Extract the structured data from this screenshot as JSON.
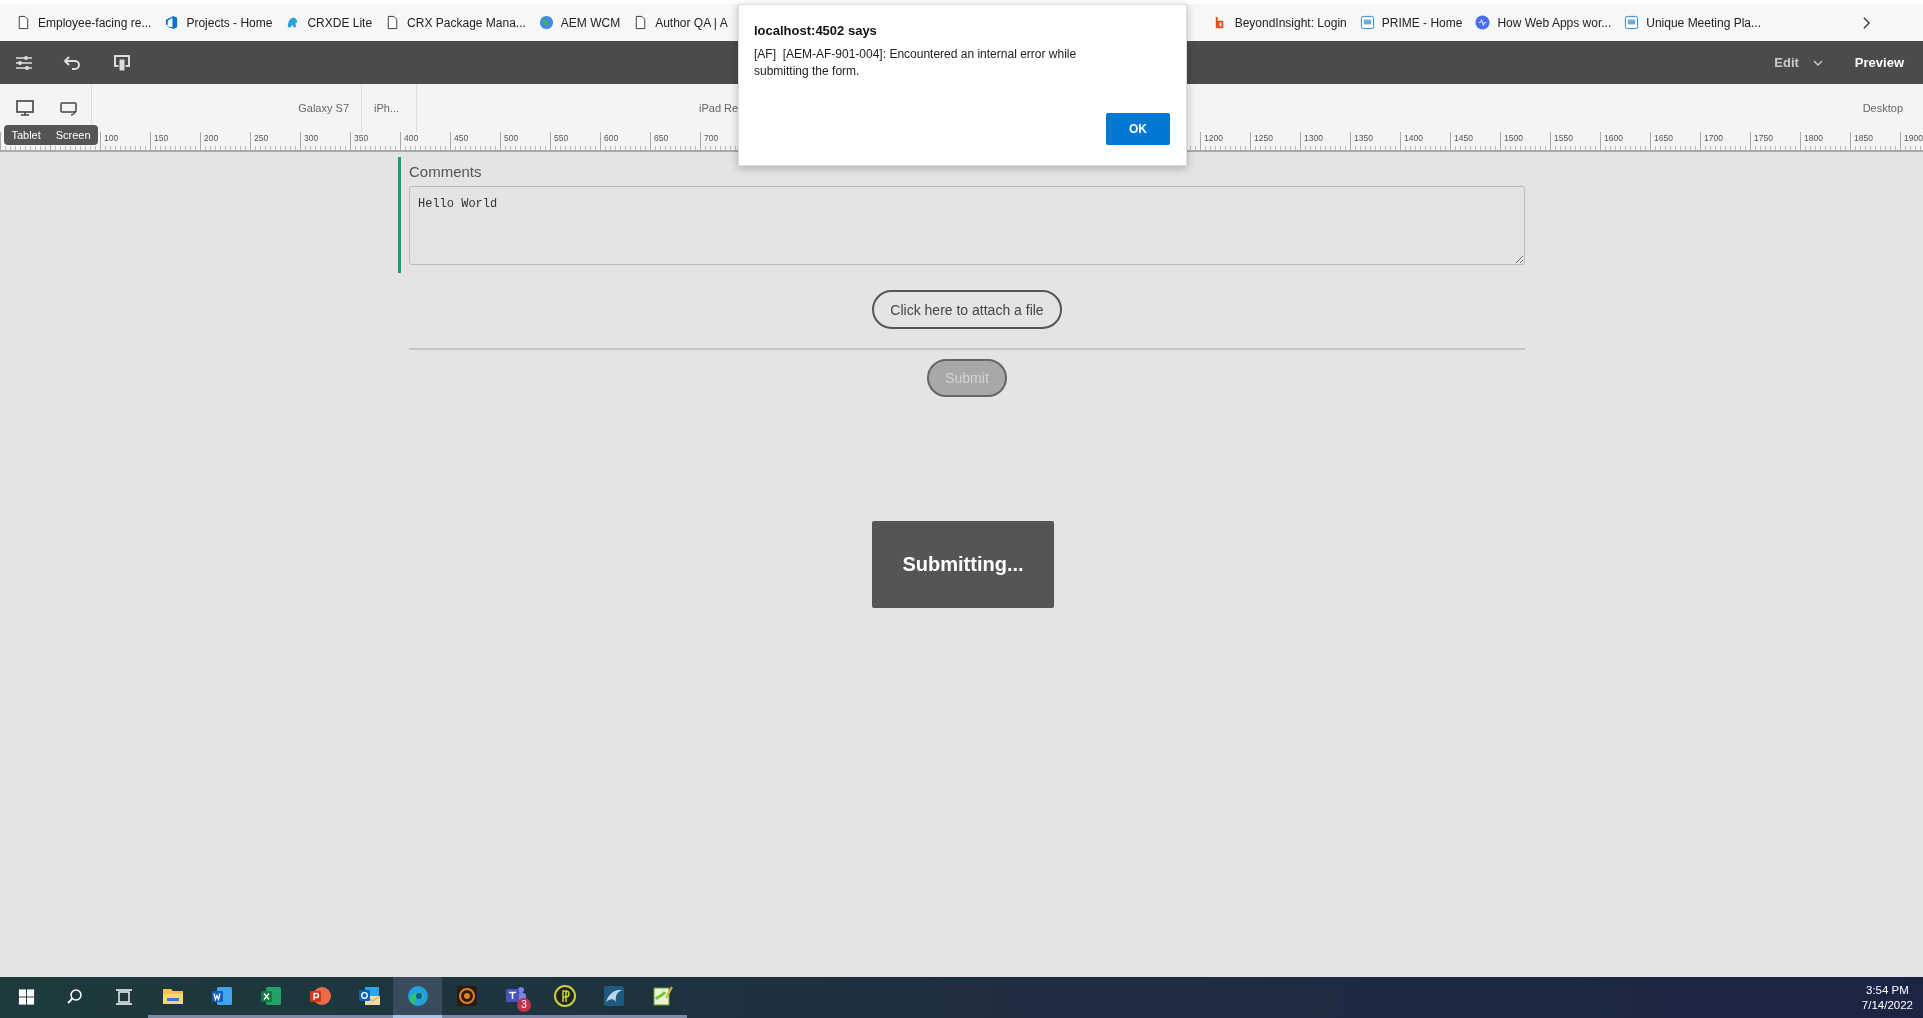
{
  "bookmarks_left": [
    {
      "kind": "page",
      "label": "Employee-facing re..."
    },
    {
      "kind": "devops",
      "label": "Projects - Home"
    },
    {
      "kind": "crxde",
      "label": "CRXDE Lite"
    },
    {
      "kind": "page",
      "label": "CRX Package Mana..."
    },
    {
      "kind": "globe",
      "label": "AEM WCM"
    },
    {
      "kind": "page",
      "label": "Author QA | A"
    }
  ],
  "bookmarks_right": [
    {
      "kind": "beyond",
      "label": "BeyondInsight: Login"
    },
    {
      "kind": "square",
      "label": "PRIME - Home"
    },
    {
      "kind": "wave",
      "label": "How Web Apps wor..."
    },
    {
      "kind": "square",
      "label": "Unique Meeting Pla..."
    }
  ],
  "toolbar": {
    "mode": "Edit",
    "preview": "Preview"
  },
  "emulator": {
    "devices": [
      "Galaxy S7",
      "iPh...",
      "iPad Re"
    ],
    "desktop": "Desktop",
    "tooltip": [
      "Tablet",
      "Screen"
    ]
  },
  "ruler": {
    "left_labels": [
      "100",
      "150",
      "200",
      "250",
      "300",
      "350",
      "400",
      "450",
      "500",
      "550",
      "600",
      "650",
      "700"
    ],
    "right_labels": [
      "1200",
      "1250",
      "1300",
      "1350",
      "1400",
      "1450",
      "1500",
      "1550",
      "1600",
      "1650",
      "1700",
      "1750",
      "1800",
      "1850",
      "1900"
    ]
  },
  "form": {
    "comments_label": "Comments",
    "comments_value": "Hello World",
    "attach_button": "Click here to attach a file",
    "submit": {
      "label": "Submit",
      "disabled": true
    }
  },
  "overlay": {
    "message": "Submitting..."
  },
  "dialog": {
    "title": "localhost:4502 says",
    "message": "[AF]  [AEM-AF-901-004]: Encountered an internal error while submitting the form.",
    "button": "OK"
  },
  "taskbar": {
    "apps": [
      {
        "kind": "explorer",
        "selected": false
      },
      {
        "kind": "word",
        "selected": false
      },
      {
        "kind": "excel",
        "selected": false
      },
      {
        "kind": "powerpoint",
        "selected": false
      },
      {
        "kind": "outlook",
        "selected": false
      },
      {
        "kind": "edge",
        "selected": true
      },
      {
        "kind": "orange",
        "selected": false
      },
      {
        "kind": "teams",
        "selected": false,
        "badge": "3"
      },
      {
        "kind": "yellow",
        "selected": false
      },
      {
        "kind": "dolphin",
        "selected": false
      },
      {
        "kind": "notepad",
        "selected": false
      }
    ],
    "time": "3:54 PM",
    "date": "7/14/2022"
  }
}
